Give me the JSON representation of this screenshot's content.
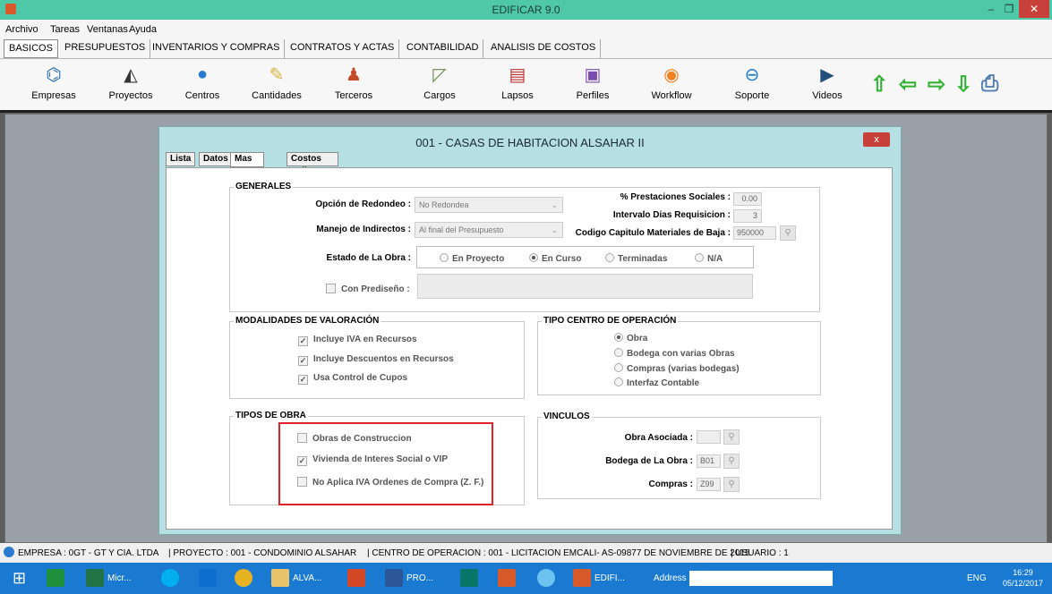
{
  "window": {
    "title": "EDIFICAR 9.0",
    "minimize": "–",
    "restore": "❐",
    "close": "✕"
  },
  "menu": [
    "Archivo",
    "Tareas",
    "Ventanas",
    "Ayuda"
  ],
  "main_tabs": [
    "BASICOS",
    "PRESUPUESTOS",
    "INVENTARIOS Y COMPRAS",
    "CONTRATOS Y ACTAS",
    "CONTABILIDAD",
    "ANALISIS DE COSTOS"
  ],
  "toolbar": [
    {
      "label": "Empresas",
      "icon": "satellite-icon"
    },
    {
      "label": "Proyectos",
      "icon": "building-icon"
    },
    {
      "label": "Centros",
      "icon": "globe-icon"
    },
    {
      "label": "Cantidades",
      "icon": "notepad-icon"
    },
    {
      "label": "Terceros",
      "icon": "person-icon"
    },
    {
      "label": "Cargos",
      "icon": "dish-icon"
    },
    {
      "label": "Lapsos",
      "icon": "calendar-icon"
    },
    {
      "label": "Perfiles",
      "icon": "window-icon"
    },
    {
      "label": "Workflow",
      "icon": "workflow-icon"
    },
    {
      "label": "Soporte",
      "icon": "support-icon"
    },
    {
      "label": "Videos",
      "icon": "video-icon"
    }
  ],
  "dialog": {
    "title": "001 - CASAS DE HABITACION ALSAHAR II",
    "close": "x",
    "tabs": [
      "Lista",
      "Datos",
      "Mas Datos",
      "Costos Indirectos"
    ],
    "generales": {
      "title": "GENERALES",
      "redondeo_label": "Opción de Redondeo :",
      "redondeo_value": "No Redondea",
      "indirectos_label": "Manejo de Indirectos :",
      "indirectos_value": "Al final del Presupuesto",
      "prestaciones_label": "% Prestaciones Sociales :",
      "prestaciones_value": "0.00",
      "intervalo_label": "Intervalo Dias Requisicion :",
      "intervalo_value": "3",
      "codigo_label": "Codigo Capitulo Materiales de Baja :",
      "codigo_value": "950000",
      "estado_label": "Estado de La Obra :",
      "estado_options": [
        "En Proyecto",
        "En Curso",
        "Terminadas",
        "N/A"
      ],
      "prediseno_label": "Con Prediseño :"
    },
    "modalidades": {
      "title": "MODALIDADES DE VALORACIÓN",
      "items": [
        "Incluye IVA en Recursos",
        "Incluye Descuentos en Recursos",
        "Usa Control de Cupos"
      ]
    },
    "tipo_centro": {
      "title": "TIPO CENTRO DE OPERACIÓN",
      "options": [
        "Obra",
        "Bodega con varias Obras",
        "Compras (varias bodegas)",
        "Interfaz Contable"
      ]
    },
    "tipos_obra": {
      "title": "TIPOS DE OBRA",
      "items": [
        "Obras de Construccion",
        "Vivienda de Interes Social o VIP",
        "No Aplica IVA Ordenes de Compra (Z. F.)"
      ]
    },
    "vinculos": {
      "title": "VINCULOS",
      "obra_label": "Obra Asociada :",
      "obra_value": "",
      "bodega_label": "Bodega de La Obra :",
      "bodega_value": "B01",
      "compras_label": "Compras :",
      "compras_value": "Z99"
    }
  },
  "status": {
    "empresa": "EMPRESA : 0GT - GT Y CIA. LTDA",
    "proyecto": "| PROYECTO : 001 - CONDOMINIO ALSAHAR",
    "centro": "| CENTRO DE OPERACION : 001 - LICITACION EMCALI- AS-09877 DE NOVIEMBRE DE 2015",
    "usuario": "| USUARIO : 1"
  },
  "taskbar": {
    "items": [
      "Micr...",
      "ALVA...",
      "PRO...",
      "EDIFI..."
    ],
    "address": "Address",
    "lang": "ENG",
    "time": "16:29",
    "date": "05/12/2017"
  }
}
